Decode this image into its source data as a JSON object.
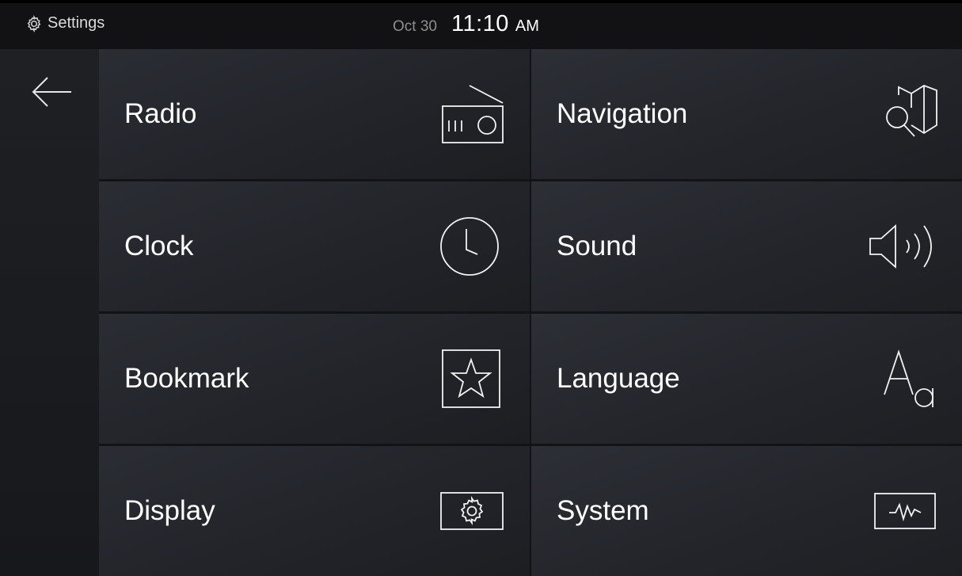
{
  "status_bar": {
    "app_icon": "gear-icon",
    "title": "Settings",
    "date": "Oct 30",
    "time": "11:10",
    "ampm": "AM"
  },
  "sidebar": {
    "back_icon": "back-arrow-icon"
  },
  "tiles": [
    {
      "label": "Radio",
      "icon": "radio-icon"
    },
    {
      "label": "Navigation",
      "icon": "map-search-icon"
    },
    {
      "label": "Clock",
      "icon": "clock-icon"
    },
    {
      "label": "Sound",
      "icon": "speaker-icon"
    },
    {
      "label": "Bookmark",
      "icon": "star-icon"
    },
    {
      "label": "Language",
      "icon": "language-icon"
    },
    {
      "label": "Display",
      "icon": "display-gear-icon"
    },
    {
      "label": "System",
      "icon": "system-pulse-icon"
    }
  ],
  "colors": {
    "background": "#121316",
    "tile": "#25272c",
    "text": "#ffffff",
    "muted": "#8d8d8d"
  }
}
